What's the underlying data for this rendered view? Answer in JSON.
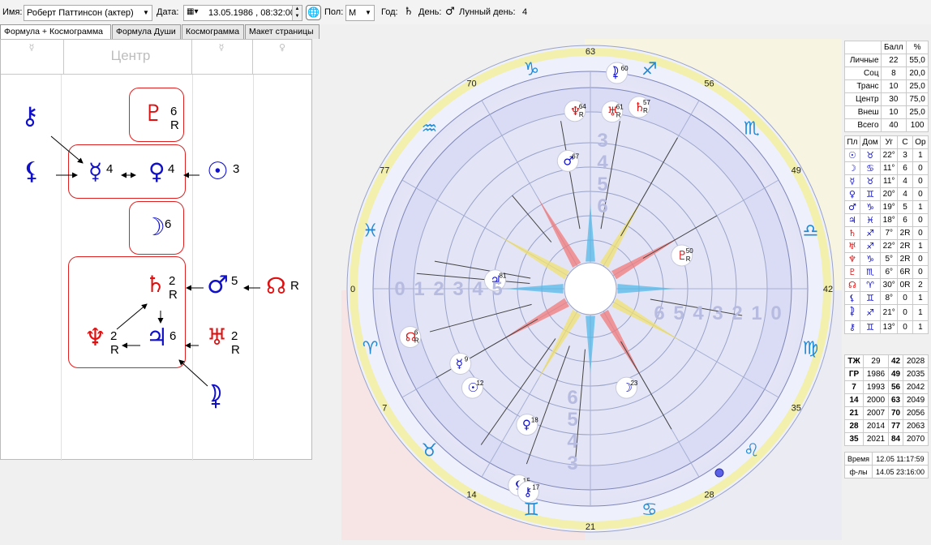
{
  "toolbar": {
    "name_label": "Имя:",
    "name_value": "Роберт Паттинсон (актер)",
    "date_label": "Дата:",
    "date_value": "13.05.1986 , 08:32:00",
    "sex_label": "Пол:",
    "sex_value": "М",
    "year_label": "Год:",
    "year_glyph": "♄",
    "day_label": "День:",
    "day_glyph": "♂",
    "lunar_label": "Лунный день:",
    "lunar_value": "4"
  },
  "tabs": [
    "Формула + Космограмма",
    "Формула Души",
    "Космограмма",
    "Макет страницы"
  ],
  "formula": {
    "headers": {
      "left": "☿",
      "center": "Центр",
      "right1": "☿",
      "right2": "♀"
    },
    "chiron": "⚷",
    "lilith": "⚸",
    "pluto": "♇",
    "pluto_num": "6",
    "pluto_r": "R",
    "mercury": "☿",
    "mercury_num": "4",
    "venus": "♀",
    "venus_num": "4",
    "sun": "☉",
    "sun_num": "3",
    "moon": "☽",
    "moon_num": "6",
    "saturn": "♄",
    "saturn_num": "2",
    "saturn_r": "R",
    "mars": "♂",
    "mars_num": "5",
    "node": "☊",
    "node_r": "R",
    "neptune": "♆",
    "neptune_num": "2",
    "neptune_r": "R",
    "jupiter": "♃",
    "jupiter_num": "6",
    "uranus": "♅",
    "uranus_num": "2",
    "uranus_r": "R",
    "selena": "⯝"
  },
  "chart": {
    "zodiac": [
      "♈",
      "♉",
      "♊",
      "♋",
      "♌",
      "♍",
      "♎",
      "♏",
      "♐",
      "♑",
      "♒",
      "♓"
    ],
    "age_marks": [
      "0",
      "7",
      "14",
      "21",
      "28",
      "35",
      "42",
      "49",
      "56",
      "63",
      "70",
      "77"
    ],
    "minor_marks": [
      "35",
      "42",
      "49",
      "56",
      "63",
      "70",
      "77"
    ],
    "planets": [
      {
        "g": "☽",
        "n": "23",
        "r": ""
      },
      {
        "g": "♃",
        "n": "81",
        "r": ""
      },
      {
        "g": "♂",
        "n": "67",
        "r": ""
      },
      {
        "g": "♇",
        "n": "50",
        "r": "R"
      },
      {
        "g": "♆",
        "n": "64",
        "r": "R"
      },
      {
        "g": "♅",
        "n": "61",
        "r": "R"
      },
      {
        "g": "♄",
        "n": "57",
        "r": "R"
      },
      {
        "g": "⯝",
        "n": "60",
        "r": ""
      },
      {
        "g": "☿",
        "n": "9",
        "r": ""
      },
      {
        "g": "☉",
        "n": "12",
        "r": ""
      },
      {
        "g": "♀",
        "n": "18",
        "r": ""
      },
      {
        "g": "☊",
        "n": "6",
        "r": "R"
      },
      {
        "g": "⚸",
        "n": "15",
        "r": ""
      },
      {
        "g": "⚷",
        "n": "17",
        "r": ""
      }
    ],
    "house_scale_left": [
      "0",
      "1",
      "2",
      "3",
      "4",
      "5"
    ],
    "house_scale_right": [
      "6",
      "5",
      "4",
      "3",
      "2",
      "1",
      "0"
    ],
    "house_scale_top": [
      "3",
      "4",
      "5",
      "6"
    ],
    "house_scale_bottom": [
      "6",
      "5",
      "4",
      "3"
    ]
  },
  "score_table": {
    "headers": [
      "",
      "Балл",
      "%"
    ],
    "rows": [
      [
        "Личные",
        "22",
        "55,0"
      ],
      [
        "Соц",
        "8",
        "20,0"
      ],
      [
        "Транс",
        "10",
        "25,0"
      ],
      [
        "Центр",
        "30",
        "75,0"
      ],
      [
        "Внеш",
        "10",
        "25,0"
      ],
      [
        "Всего",
        "40",
        "100"
      ]
    ]
  },
  "planet_table": {
    "headers": [
      "Пл",
      "Дом",
      "Уг",
      "С",
      "Ор"
    ],
    "rows": [
      [
        "☉",
        "♉",
        "22°",
        "3",
        "1"
      ],
      [
        "☽",
        "♋",
        "11°",
        "6",
        "0"
      ],
      [
        "☿",
        "♉",
        "11°",
        "4",
        "0"
      ],
      [
        "♀",
        "♊",
        "20°",
        "4",
        "0"
      ],
      [
        "♂",
        "♑",
        "19°",
        "5",
        "1"
      ],
      [
        "♃",
        "♓",
        "18°",
        "6",
        "0"
      ],
      [
        "♄",
        "♐",
        "7°",
        "2R",
        "0"
      ],
      [
        "♅",
        "♐",
        "22°",
        "2R",
        "1"
      ],
      [
        "♆",
        "♑",
        "5°",
        "2R",
        "0"
      ],
      [
        "♇",
        "♏",
        "6°",
        "6R",
        "0"
      ],
      [
        "☊",
        "♈",
        "30°",
        "0R",
        "2"
      ],
      [
        "⚸",
        "♊",
        "8°",
        "0",
        "1"
      ],
      [
        "⯝",
        "♐",
        "21°",
        "0",
        "1"
      ],
      [
        "⚷",
        "♊",
        "13°",
        "0",
        "1"
      ]
    ]
  },
  "cycle_table": {
    "rows": [
      [
        "ТЖ",
        "29",
        "42",
        "2028"
      ],
      [
        "ГР",
        "1986",
        "49",
        "2035"
      ],
      [
        "7",
        "1993",
        "56",
        "2042"
      ],
      [
        "14",
        "2000",
        "63",
        "2049"
      ],
      [
        "21",
        "2007",
        "70",
        "2056"
      ],
      [
        "28",
        "2014",
        "77",
        "2063"
      ],
      [
        "35",
        "2021",
        "84",
        "2070"
      ]
    ]
  },
  "time_table": {
    "rows": [
      [
        "Время",
        "12.05 11:17:59"
      ],
      [
        "ф-лы",
        "14.05 23:16:00"
      ]
    ]
  }
}
